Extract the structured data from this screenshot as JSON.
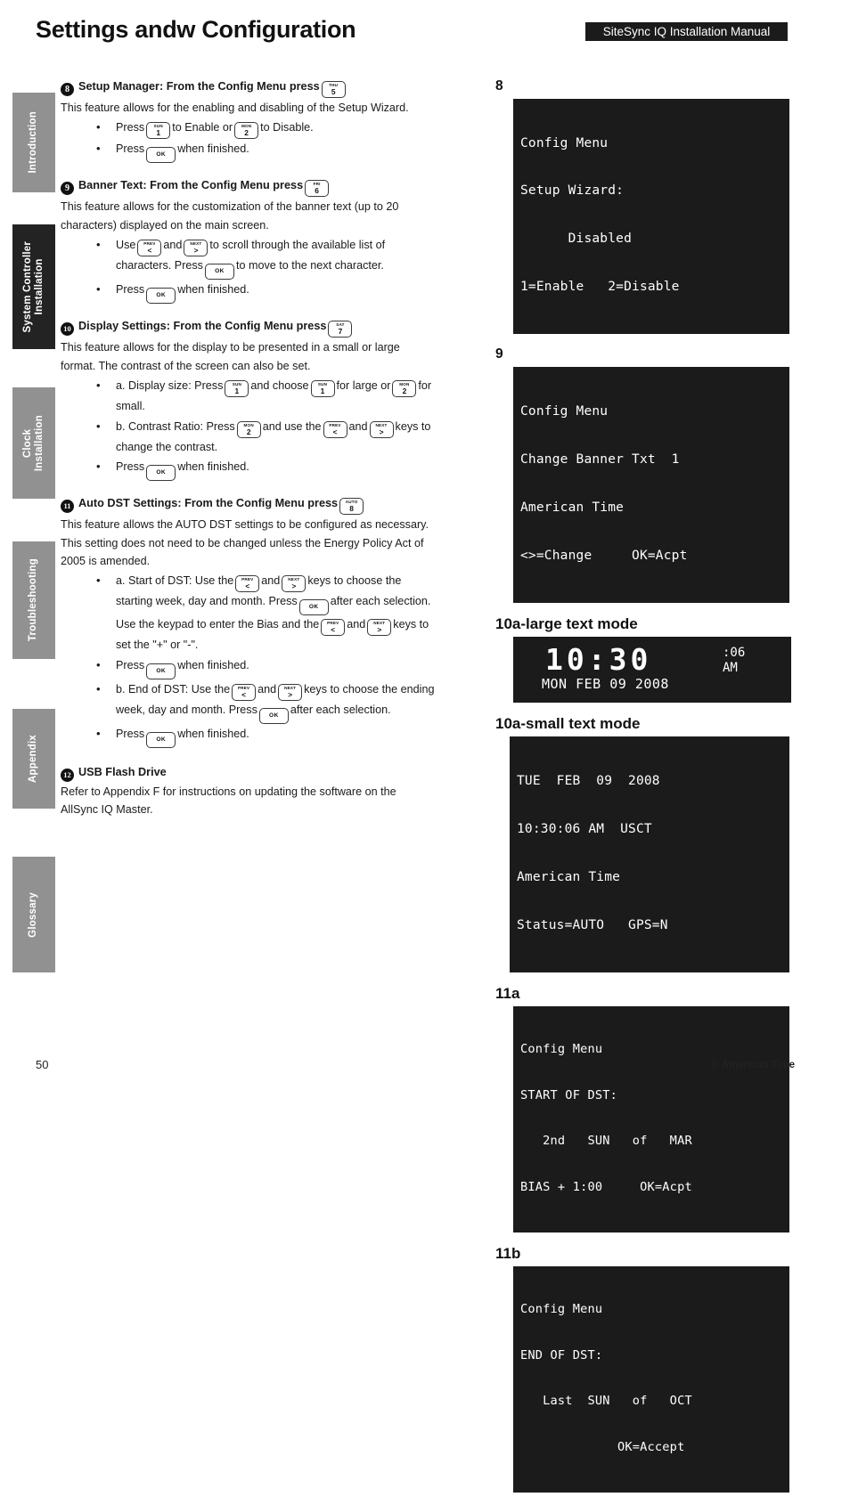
{
  "header": {
    "title": "Settings andw Configuration",
    "manual_banner": "SiteSync IQ Installation Manual"
  },
  "sidebar": {
    "tabs": [
      {
        "id": "introduction",
        "label": "Introduction",
        "active": false
      },
      {
        "id": "system-controller-installation",
        "label": "System Controller\nInstallation",
        "active": true
      },
      {
        "id": "clock-installation",
        "label": "Clock\nInstallation",
        "active": false
      },
      {
        "id": "troubleshooting",
        "label": "Troubleshooting",
        "active": false
      },
      {
        "id": "appendix",
        "label": "Appendix",
        "active": false
      },
      {
        "id": "glossary",
        "label": "Glossary",
        "active": false
      }
    ]
  },
  "keys": {
    "thu5": {
      "top": "THU",
      "bottom": "5"
    },
    "fri6": {
      "top": "FRI",
      "bottom": "6"
    },
    "sat7": {
      "top": "SAT",
      "bottom": "7"
    },
    "auto8": {
      "top": "AUTO",
      "bottom": "8"
    },
    "sun1": {
      "top": "SUN",
      "bottom": "1"
    },
    "mon2": {
      "top": "MON",
      "bottom": "2"
    },
    "prev": {
      "top": "PREV",
      "bottom": "<"
    },
    "next": {
      "top": "NEXT",
      "bottom": ">"
    },
    "ok": {
      "top": "",
      "bottom": "OK"
    }
  },
  "items": {
    "item8": {
      "number": "8",
      "heading": "Setup Manager: From the Config Menu press",
      "body": "This feature allows for the enabling and disabling of the Setup Wizard.",
      "b1_a": "Press",
      "b1_b": "to Enable or",
      "b1_c": "to Disable.",
      "b2_a": "Press",
      "b2_b": "when finished."
    },
    "item9": {
      "number": "9",
      "heading": "Banner Text: From the Config Menu press",
      "body": "This feature allows for the customization of the banner text (up to 20 characters) displayed on the main screen.",
      "b1_a": "Use",
      "b1_b": "and",
      "b1_c": "to scroll through the available list of characters. Press",
      "b1_d": "to move to the next character.",
      "b2_a": "Press",
      "b2_b": "when finished."
    },
    "item10": {
      "number": "10",
      "heading": "Display Settings: From the Config Menu press",
      "body": "This feature allows for the display to be presented in a small or large format. The contrast of the screen can also be set.",
      "b1_a": "a. Display size: Press",
      "b1_b": "and choose",
      "b1_c": "for large or",
      "b1_d": "for small.",
      "b2_a": "b. Contrast Ratio: Press",
      "b2_b": "and use the",
      "b2_c": "and",
      "b2_d": "keys to change the contrast.",
      "b3_a": "Press",
      "b3_b": "when finished."
    },
    "item11": {
      "number": "11",
      "heading": "Auto DST Settings: From the Config Menu press",
      "body": "This feature allows the AUTO DST settings to be configured as necessary. This setting does not need to be changed unless the Energy Policy Act of 2005 is amended.",
      "b1_a": "a. Start of DST: Use the",
      "b1_b": "and",
      "b1_c": "keys to choose the starting week, day and month. Press",
      "b1_d": "after each selection. Use the keypad to enter the Bias and the",
      "b1_e": "and",
      "b1_f": "keys to set the \"+\" or \"-\".",
      "b2_a": "Press",
      "b2_b": "when finished.",
      "b3_a": "b. End of DST: Use the",
      "b3_b": "and",
      "b3_c": "keys to choose the ending week, day and month. Press",
      "b3_d": "after each selection.",
      "b4_a": "Press",
      "b4_b": "when finished."
    },
    "item12": {
      "number": "12",
      "heading": "USB Flash Drive",
      "body": "Refer to Appendix F for instructions on updating the software on the AllSync IQ Master."
    }
  },
  "figures": {
    "fig8": {
      "label": "8",
      "lines": [
        "Config Menu",
        "Setup Wizard:",
        "      Disabled",
        "1=Enable   2=Disable"
      ]
    },
    "fig9": {
      "label": "9",
      "lines": [
        "Config Menu",
        "Change Banner Txt  1",
        "American Time",
        "<>=Change     OK=Acpt"
      ]
    },
    "fig10a_large": {
      "label": "10a-large text mode",
      "time": "10:30",
      "seconds": ":06",
      "ampm": "AM",
      "date": "MON FEB 09 2008"
    },
    "fig10a_small": {
      "label": "10a-small text mode",
      "lines": [
        "TUE  FEB  09  2008",
        "10:30:06 AM  USCT",
        "American Time",
        "Status=AUTO   GPS=N"
      ]
    },
    "fig11a": {
      "label": "11a",
      "lines": [
        "Config Menu",
        "START OF DST:",
        "   2nd   SUN   of   MAR",
        "BIAS + 1:00     OK=Acpt"
      ]
    },
    "fig11b": {
      "label": "11b",
      "lines": [
        "Config Menu",
        "END OF DST:",
        "   Last  SUN   of   OCT",
        "             OK=Accept"
      ]
    }
  },
  "footer": {
    "page_number": "50",
    "copyright": "© American Time"
  },
  "colors": {
    "tab_inactive": "#919191",
    "tab_active": "#232323",
    "lcd_background": "#1b1b1b",
    "lcd_text": "#ffffff"
  }
}
